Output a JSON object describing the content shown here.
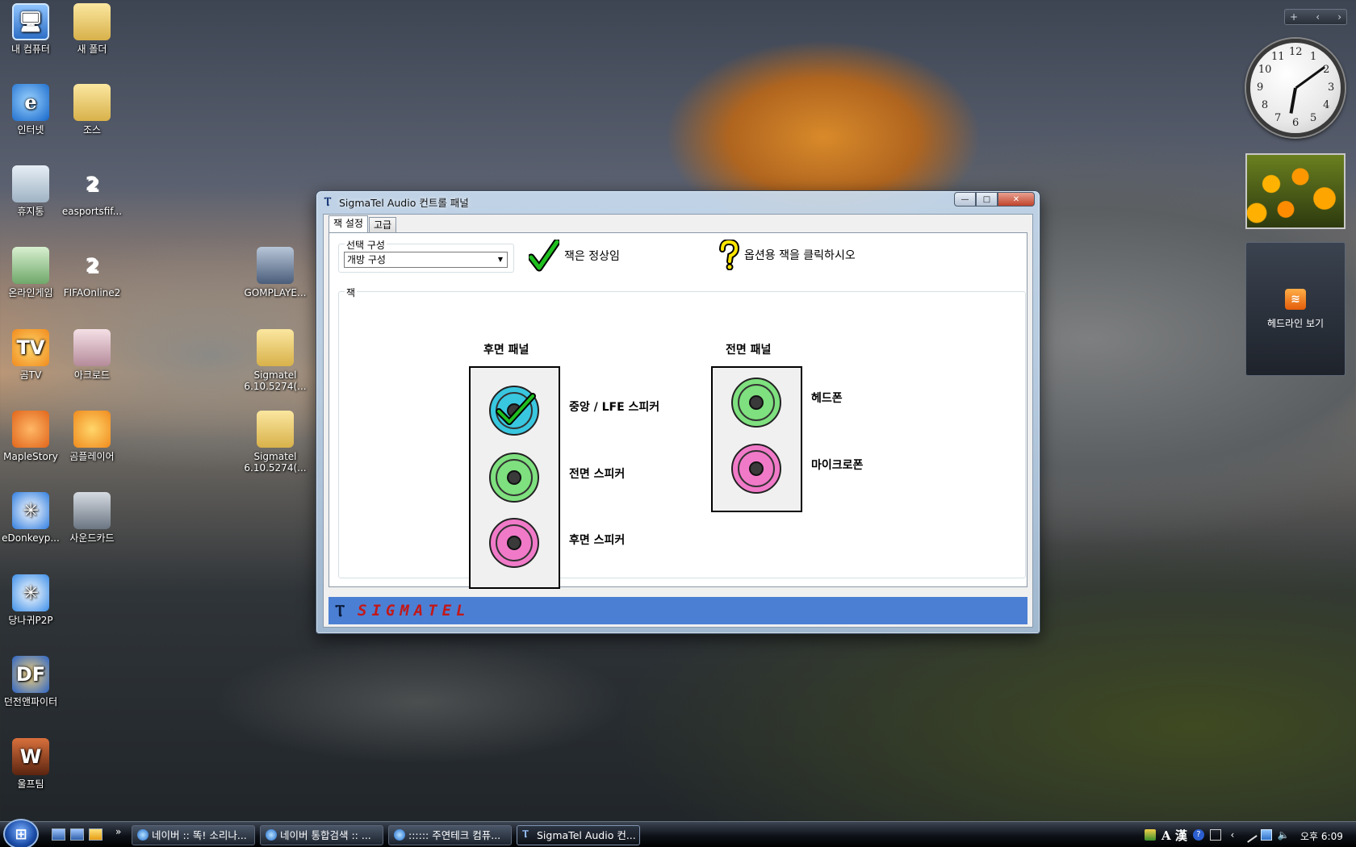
{
  "desktop": {
    "icons": [
      {
        "label": "내 컴퓨터",
        "glyph": "🖥",
        "cls": "g-computer"
      },
      {
        "label": "새 폴더",
        "glyph": "",
        "cls": "g-folder"
      },
      {
        "label": "인터넷",
        "glyph": "e",
        "cls": "g-ie"
      },
      {
        "label": "조스",
        "glyph": "",
        "cls": "g-folder"
      },
      {
        "label": "휴지통",
        "glyph": "",
        "cls": "g-bin"
      },
      {
        "label": "easportsfif...",
        "glyph": "2",
        "cls": "g-two"
      },
      {
        "label": "온라인게임",
        "glyph": "",
        "cls": "g-game"
      },
      {
        "label": "FIFAOnline2",
        "glyph": "2",
        "cls": "g-two"
      },
      {
        "label": "GOMPLAYE...",
        "glyph": "",
        "cls": "g-gomp"
      },
      {
        "label": "곰TV",
        "glyph": "TV",
        "cls": "g-gom"
      },
      {
        "label": "아크로드",
        "glyph": "",
        "cls": "g-arc"
      },
      {
        "label": "Sigmatel 6.10.5274(...",
        "glyph": "",
        "cls": "g-folder"
      },
      {
        "label": "MapleStory",
        "glyph": "",
        "cls": "g-maple"
      },
      {
        "label": "곰플레이어",
        "glyph": "",
        "cls": "g-gom"
      },
      {
        "label": "Sigmatel 6.10.5274(...",
        "glyph": "",
        "cls": "g-folder"
      },
      {
        "label": "eDonkeyp...",
        "glyph": "✳",
        "cls": "g-edonkey"
      },
      {
        "label": "사운드카드",
        "glyph": "",
        "cls": "g-sound"
      },
      {
        "label": "당나귀P2P",
        "glyph": "✳",
        "cls": "g-dang"
      },
      {
        "label": "던전앤파이터",
        "glyph": "DF",
        "cls": "g-dnf"
      },
      {
        "label": "울프팀",
        "glyph": "W",
        "cls": "g-ulf"
      }
    ]
  },
  "sidebar": {
    "top_controls": {
      "add": "+",
      "prev": "‹",
      "next": "›"
    },
    "clock_numbers": [
      "12",
      "1",
      "2",
      "3",
      "4",
      "5",
      "6",
      "7",
      "8",
      "9",
      "10",
      "11"
    ],
    "feed_label": "헤드라인 보기"
  },
  "window": {
    "title": "SigmaTel Audio 컨트롤 패널",
    "controls": {
      "minimize": "—",
      "maximize": "□",
      "close": "✕"
    },
    "tabs": [
      {
        "label": "잭 설정",
        "active": true
      },
      {
        "label": "고급",
        "active": false
      }
    ],
    "config_group": {
      "legend": "선택 구성",
      "selected": "개방 구성"
    },
    "status_ok": "잭은 정상임",
    "status_hint": "옵션용 잭을 클릭하시오",
    "jack_group_legend": "잭",
    "rear_panel": {
      "title": "후면 패널",
      "jacks": [
        {
          "label": "중앙 / LFE 스피커",
          "color": "#39c7e0",
          "checked": true
        },
        {
          "label": "전면 스피커",
          "color": "#7ee07e",
          "checked": false
        },
        {
          "label": "후면 스피커",
          "color": "#f07ac8",
          "checked": false
        }
      ]
    },
    "front_panel": {
      "title": "전면 패널",
      "jacks": [
        {
          "label": "헤드폰",
          "color": "#7ee07e"
        },
        {
          "label": "마이크로폰",
          "color": "#f07ac8"
        }
      ]
    },
    "brand": "SIGMATEL"
  },
  "taskbar": {
    "quick_more": "»",
    "buttons": [
      {
        "label": "네이버 :: 똑! 소리나...",
        "active": false
      },
      {
        "label": "네이버 통합검색 :: ...",
        "active": false
      },
      {
        "label": ":::::: 주연테크 컴퓨...",
        "active": false
      },
      {
        "label": "SigmaTel Audio 컨...",
        "active": true
      }
    ],
    "tray_lang": "A 漢",
    "time": "오후 6:09"
  }
}
